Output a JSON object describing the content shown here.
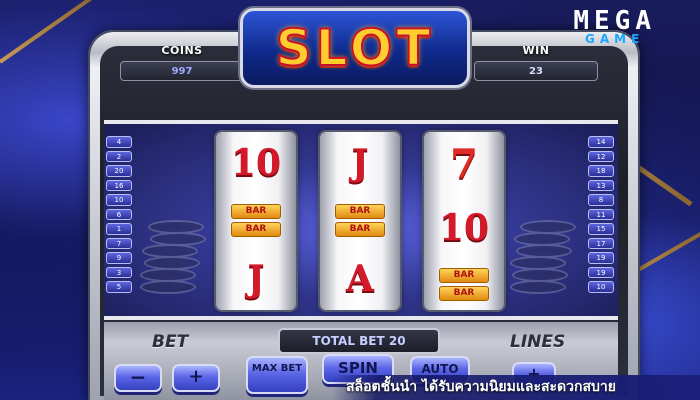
{
  "brand": {
    "title": "SLOT",
    "mega_top": "MEGA",
    "mega_bottom": "GAME"
  },
  "stats": {
    "coins": {
      "label": "COINS",
      "value": "997"
    },
    "win": {
      "label": "WIN",
      "value": "23"
    }
  },
  "lines_left": [
    "4",
    "2",
    "20",
    "16",
    "10",
    "6",
    "1",
    "7",
    "9",
    "3",
    "5"
  ],
  "lines_right": [
    "14",
    "12",
    "18",
    "13",
    "8",
    "11",
    "15",
    "17",
    "19",
    "19",
    "10"
  ],
  "reels": [
    [
      {
        "type": "text",
        "value": "10"
      },
      {
        "type": "bar",
        "value": "BAR"
      },
      {
        "type": "text",
        "value": "J"
      }
    ],
    [
      {
        "type": "text",
        "value": "J"
      },
      {
        "type": "bar",
        "value": "BAR"
      },
      {
        "type": "text",
        "value": "A"
      }
    ],
    [
      {
        "type": "seven",
        "value": "7"
      },
      {
        "type": "text",
        "value": "10"
      },
      {
        "type": "bar",
        "value": "BAR"
      }
    ]
  ],
  "controls": {
    "bet_label": "BET",
    "lines_label": "LINES",
    "total_bet": "TOTAL BET 20",
    "minus": "−",
    "plus": "+",
    "max_bet": "MAX BET",
    "spin": "SPIN",
    "auto": "AUTO"
  },
  "banner": "สล็อตชั้นนำ ได้รับความนิยมและสะดวกสบาย",
  "colors": {
    "accent": "#5c67e6",
    "gold": "#ffce2e",
    "red": "#d41a2a"
  }
}
